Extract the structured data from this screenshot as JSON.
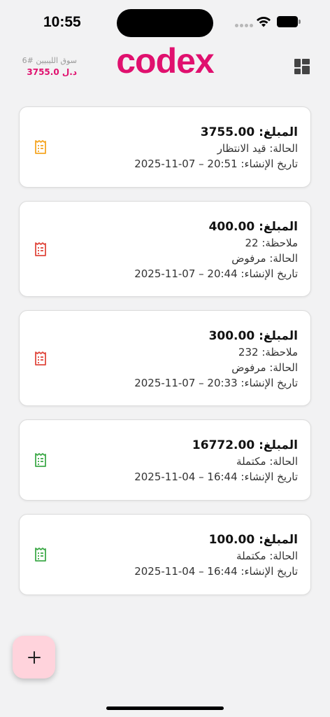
{
  "status_bar": {
    "time": "10:55"
  },
  "header": {
    "market_name": "سوق الليبيين #6",
    "market_balance": "3755.0 د.ل",
    "logo": "codex"
  },
  "transactions": [
    {
      "amount_label": "المبلغ:",
      "amount": "3755.00",
      "status": "الحالة: قيد الانتظار",
      "created_label": "تاريخ الإنشاء:",
      "created_value": "2025-11-07 – 20:51",
      "icon": "receipt-icon",
      "icon_color": "#f5a623"
    },
    {
      "amount_label": "المبلغ:",
      "amount": "400.00",
      "note": "ملاحظة: 22",
      "status": "الحالة: مرفوض",
      "created_label": "تاريخ الإنشاء:",
      "created_value": "2025-11-07 – 20:44",
      "icon": "receipt-icon",
      "icon_color": "#e0483e"
    },
    {
      "amount_label": "المبلغ:",
      "amount": "300.00",
      "note": "ملاحظة: 232",
      "status": "الحالة: مرفوض",
      "created_label": "تاريخ الإنشاء:",
      "created_value": "2025-11-07 – 20:33",
      "icon": "receipt-icon",
      "icon_color": "#e0483e"
    },
    {
      "amount_label": "المبلغ:",
      "amount": "16772.00",
      "status": "الحالة: مكتملة",
      "created_label": "تاريخ الإنشاء:",
      "created_value": "2025-11-04 – 16:44",
      "icon": "receipt-icon",
      "icon_color": "#3faa4a"
    },
    {
      "amount_label": "المبلغ:",
      "amount": "100.00",
      "status": "الحالة: مكتملة",
      "created_label": "تاريخ الإنشاء:",
      "created_value": "2025-11-04 – 16:44",
      "icon": "receipt-icon",
      "icon_color": "#3faa4a"
    }
  ],
  "fab": {
    "icon": "plus-icon"
  },
  "colors": {
    "accent": "#e0106e",
    "fab_bg": "#ffd3dc",
    "background": "#f2f2f3"
  }
}
